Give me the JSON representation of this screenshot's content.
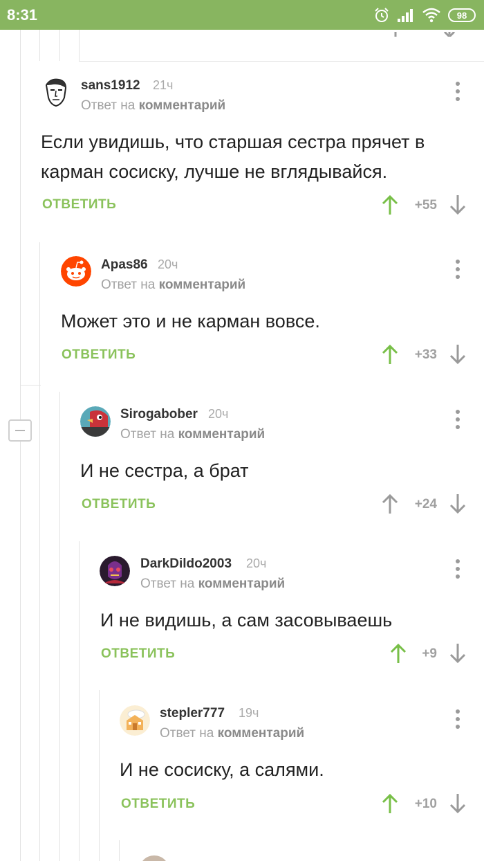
{
  "status_bar": {
    "time": "8:31",
    "battery": "98"
  },
  "colors": {
    "status_bar_bg": "#88b560",
    "reply_green": "#8ac25b",
    "upvote_green": "#78bf48",
    "neutral_gray": "#9a9a9a"
  },
  "comments": [
    {
      "username": "sans1912",
      "time": "21ч",
      "reply_prefix": "Ответ на",
      "reply_target": "комментарий",
      "text": "Если увидишь, что старшая сестра прячет в карман сосиску, лучше не вглядывайся.",
      "reply_label": "ОТВЕТИТЬ",
      "score": "+55",
      "upvoted": true,
      "avatar_icon": "sketch-portrait-avatar"
    },
    {
      "username": "Apas86",
      "time": "20ч",
      "reply_prefix": "Ответ на",
      "reply_target": "комментарий",
      "text": "Может это и не карман вовсе.",
      "reply_label": "ОТВЕТИТЬ",
      "score": "+33",
      "upvoted": true,
      "avatar_icon": "reddit-alien-avatar"
    },
    {
      "username": "Sirogabober",
      "time": "20ч",
      "reply_prefix": "Ответ на",
      "reply_target": "комментарий",
      "text": "И не сестра, а брат",
      "reply_label": "ОТВЕТИТЬ",
      "score": "+24",
      "upvoted": false,
      "avatar_icon": "red-bird-avatar"
    },
    {
      "username": "DarkDildo2003",
      "time": "20ч",
      "reply_prefix": "Ответ на",
      "reply_target": "комментарий",
      "text": "И не видишь, а сам засовываешь",
      "reply_label": "ОТВЕТИТЬ",
      "score": "+9",
      "upvoted": true,
      "avatar_icon": "dark-character-avatar"
    },
    {
      "username": "stepler777",
      "time": "19ч",
      "reply_prefix": "Ответ на",
      "reply_target": "комментарий",
      "text": "И не сосиску, а салями.",
      "reply_label": "ОТВЕТИТЬ",
      "score": "+10",
      "upvoted": true,
      "avatar_icon": "cartoon-house-avatar"
    }
  ]
}
